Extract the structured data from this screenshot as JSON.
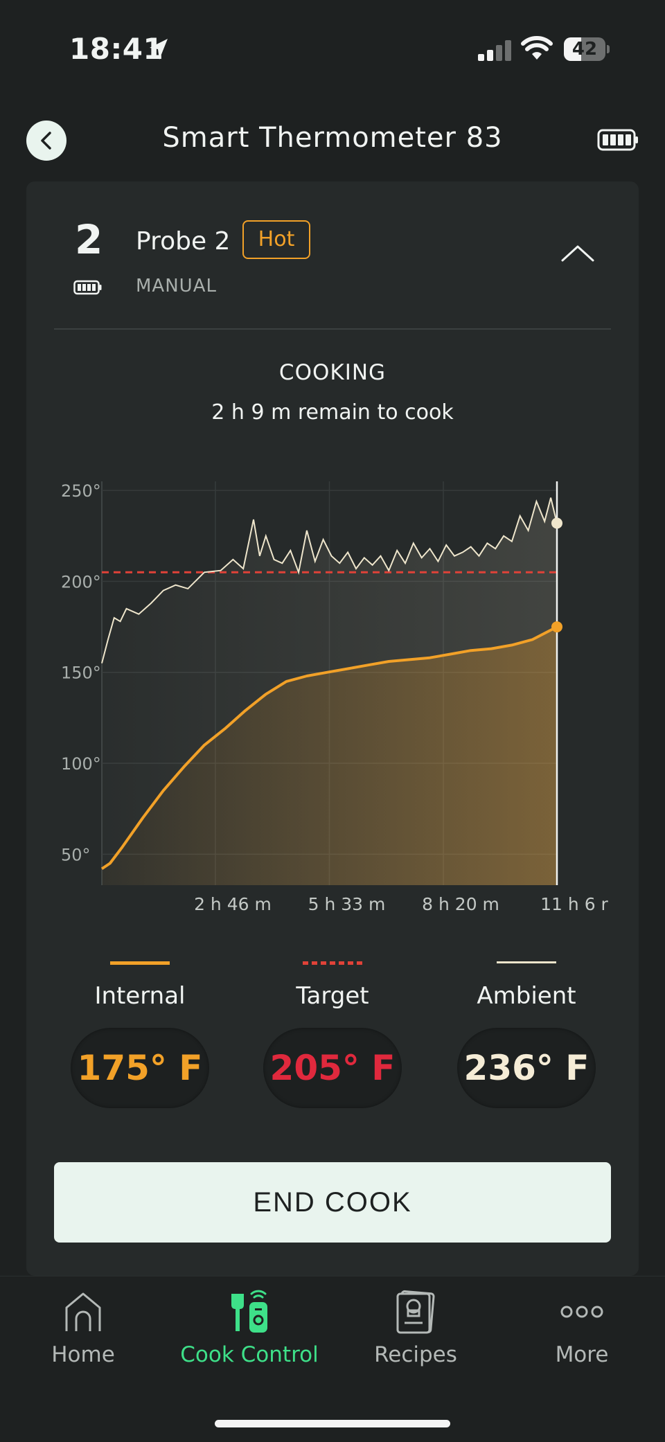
{
  "status_bar": {
    "time": "18:41",
    "battery_percent": "42",
    "battery_level": 0.42
  },
  "header": {
    "title": "Smart Thermometer 83"
  },
  "probe": {
    "number": "2",
    "name": "Probe 2",
    "badge": "Hot",
    "mode": "MANUAL",
    "status": "COOKING",
    "remaining": "2 h 9 m remain to cook"
  },
  "colors": {
    "internal": "#f2a128",
    "target": "#e04238",
    "ambient": "#efe6cc",
    "accent_green": "#3ee089"
  },
  "chart_data": {
    "type": "line",
    "y_ticks": [
      "250°",
      "200°",
      "150°",
      "100°",
      "50°"
    ],
    "y_tick_values": [
      250,
      200,
      150,
      100,
      50
    ],
    "x_ticks": [
      "2 h 46 m",
      "5 h 33 m",
      "8 h 20 m",
      "11 h 6 r"
    ],
    "x_tick_values": [
      2.77,
      5.55,
      8.33,
      11.1
    ],
    "xlim": [
      0,
      11.1
    ],
    "ylim": [
      33,
      255
    ],
    "grid": true,
    "target": 205,
    "series": [
      {
        "name": "Internal",
        "x": [
          0,
          0.2,
          0.5,
          1,
          1.5,
          2,
          2.5,
          3,
          3.5,
          4,
          4.5,
          5,
          5.5,
          6,
          6.5,
          7,
          7.5,
          8,
          8.5,
          9,
          9.5,
          10,
          10.5,
          11.1
        ],
        "values": [
          42,
          45,
          54,
          70,
          85,
          98,
          110,
          119,
          129,
          138,
          145,
          148,
          150,
          152,
          154,
          156,
          157,
          158,
          160,
          162,
          163,
          165,
          168,
          175
        ]
      },
      {
        "name": "Ambient",
        "x": [
          0,
          0.15,
          0.3,
          0.45,
          0.6,
          0.9,
          1.2,
          1.5,
          1.8,
          2.1,
          2.5,
          2.9,
          3.2,
          3.45,
          3.7,
          3.85,
          4.0,
          4.2,
          4.4,
          4.6,
          4.8,
          5.0,
          5.2,
          5.4,
          5.6,
          5.8,
          6.0,
          6.2,
          6.4,
          6.6,
          6.8,
          7.0,
          7.2,
          7.4,
          7.6,
          7.8,
          8.0,
          8.2,
          8.4,
          8.6,
          8.8,
          9.0,
          9.2,
          9.4,
          9.6,
          9.8,
          10.0,
          10.2,
          10.4,
          10.6,
          10.8,
          10.95,
          11.1
        ],
        "values": [
          155,
          168,
          180,
          178,
          185,
          182,
          188,
          195,
          198,
          196,
          205,
          206,
          212,
          207,
          234,
          214,
          225,
          212,
          210,
          217,
          205,
          228,
          211,
          223,
          214,
          210,
          216,
          207,
          213,
          209,
          214,
          206,
          217,
          210,
          221,
          213,
          218,
          211,
          220,
          214,
          216,
          219,
          214,
          221,
          218,
          225,
          222,
          236,
          228,
          244,
          233,
          246,
          232
        ]
      }
    ],
    "legend": [
      {
        "name": "Internal",
        "value": "175° F"
      },
      {
        "name": "Target",
        "value": "205° F"
      },
      {
        "name": "Ambient",
        "value": "236° F"
      }
    ]
  },
  "actions": {
    "end_cook": "END COOK"
  },
  "tabs": [
    {
      "label": "Home",
      "icon": "home-icon",
      "active": false
    },
    {
      "label": "Cook Control",
      "icon": "cook-control-icon",
      "active": true
    },
    {
      "label": "Recipes",
      "icon": "recipes-icon",
      "active": false
    },
    {
      "label": "More",
      "icon": "more-icon",
      "active": false
    }
  ]
}
